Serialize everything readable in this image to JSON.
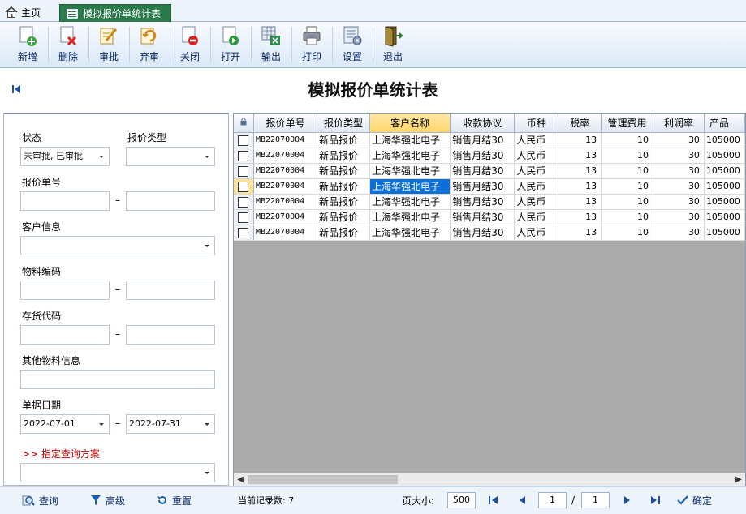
{
  "tabs": {
    "home": "主页",
    "active": "模拟报价单统计表"
  },
  "toolbar": [
    {
      "label": "新增",
      "icon": "add-doc-icon"
    },
    {
      "label": "删除",
      "icon": "delete-doc-icon"
    },
    {
      "label": "审批",
      "icon": "approve-icon"
    },
    {
      "label": "弃审",
      "icon": "unapprove-icon"
    },
    {
      "label": "关闭",
      "icon": "close-doc-icon"
    },
    {
      "label": "打开",
      "icon": "open-doc-icon"
    },
    {
      "label": "输出",
      "icon": "export-icon"
    },
    {
      "label": "打印",
      "icon": "print-icon"
    },
    {
      "label": "设置",
      "icon": "settings-icon"
    },
    {
      "label": "退出",
      "icon": "exit-icon"
    }
  ],
  "page_title": "模拟报价单统计表",
  "filters": {
    "status_label": "状态",
    "status_value": "未审批, 已审批",
    "quote_type_label": "报价类型",
    "quote_type_value": "",
    "quote_no_label": "报价单号",
    "customer_label": "客户信息",
    "material_code_label": "物料编码",
    "stock_code_label": "存货代码",
    "other_material_label": "其他物料信息",
    "date_label": "单据日期",
    "date_from": "2022-07-01",
    "date_to": "2022-07-31",
    "dash": "–",
    "scheme_label": ">> 指定查询方案"
  },
  "grid": {
    "columns": [
      "报价单号",
      "报价类型",
      "客户名称",
      "收款协议",
      "币种",
      "税率",
      "管理费用",
      "利润率",
      "产品"
    ],
    "rows": [
      [
        "MB22070004",
        "新品报价",
        "上海华强北电子",
        "销售月结30",
        "人民币",
        "13",
        "10",
        "30",
        "105000"
      ],
      [
        "MB22070004",
        "新品报价",
        "上海华强北电子",
        "销售月结30",
        "人民币",
        "13",
        "10",
        "30",
        "105000"
      ],
      [
        "MB22070004",
        "新品报价",
        "上海华强北电子",
        "销售月结30",
        "人民币",
        "13",
        "10",
        "30",
        "105000"
      ],
      [
        "MB22070004",
        "新品报价",
        "上海华强北电子",
        "销售月结30",
        "人民币",
        "13",
        "10",
        "30",
        "105000"
      ],
      [
        "MB22070004",
        "新品报价",
        "上海华强北电子",
        "销售月结30",
        "人民币",
        "13",
        "10",
        "30",
        "105000"
      ],
      [
        "MB22070004",
        "新品报价",
        "上海华强北电子",
        "销售月结30",
        "人民币",
        "13",
        "10",
        "30",
        "105000"
      ],
      [
        "MB22070004",
        "新品报价",
        "上海华强北电子",
        "销售月结30",
        "人民币",
        "13",
        "10",
        "30",
        "105000"
      ]
    ]
  },
  "bottom": {
    "query": "查询",
    "advanced": "高级",
    "reset": "重置",
    "record_count": "当前记录数: 7",
    "page_size_label": "页大小:",
    "page_size": "500",
    "page_current": "1",
    "page_sep": "/",
    "page_total": "1",
    "confirm": "确定"
  }
}
